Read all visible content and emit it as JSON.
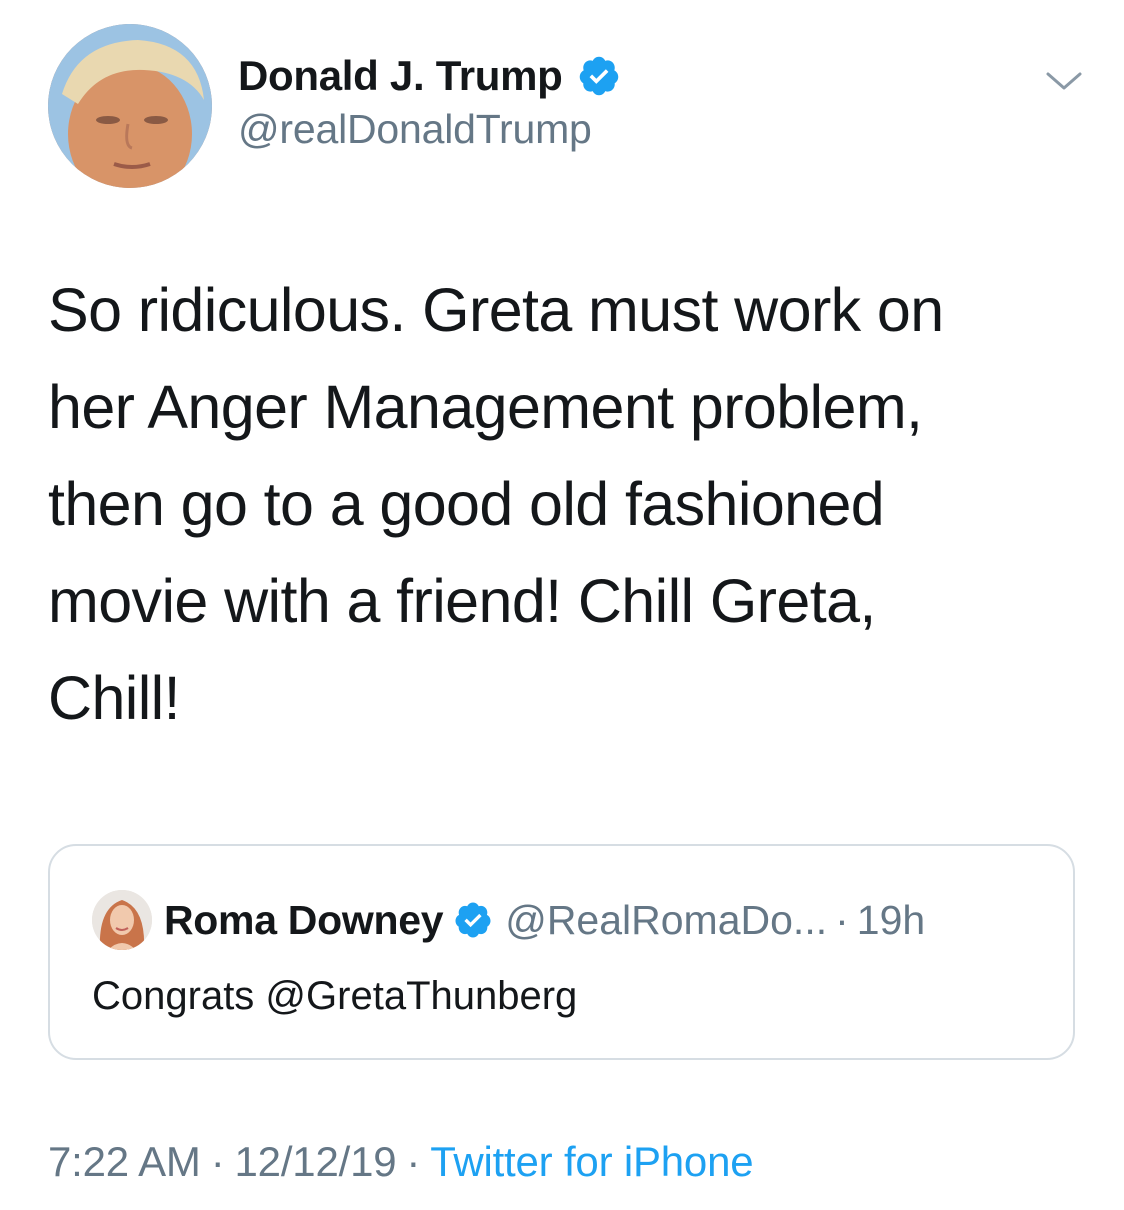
{
  "author": {
    "display_name": "Donald J. Trump",
    "handle": "@realDonaldTrump",
    "verified": true
  },
  "tweet": {
    "lines": [
      "So ridiculous. Greta must work on",
      "her Anger Management problem,",
      "then go to a good old fashioned",
      "movie with a friend! Chill Greta,",
      "Chill!"
    ]
  },
  "quoted_tweet": {
    "display_name": "Roma Downey",
    "handle": "@RealRomaDo...",
    "separator": "·",
    "time": "19h",
    "verified": true,
    "text": "Congrats @GretaThunberg"
  },
  "meta": {
    "time": "7:22 AM",
    "separator": "·",
    "date": "12/12/19",
    "source": "Twitter for iPhone"
  },
  "colors": {
    "text_primary": "#14171a",
    "text_secondary": "#657786",
    "accent": "#1da1f2",
    "border": "#d6dde3"
  },
  "icons": {
    "verified": "verified-badge-icon",
    "more": "chevron-down-icon"
  }
}
